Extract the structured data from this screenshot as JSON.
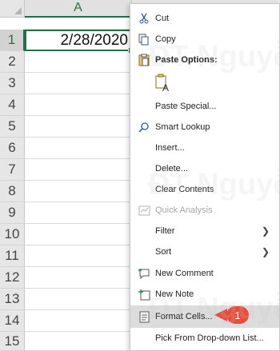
{
  "sheet": {
    "column_header": "A",
    "cell_a1": "2/28/2020",
    "row_numbers": [
      "1",
      "2",
      "3",
      "4",
      "5",
      "6",
      "7",
      "8",
      "9",
      "10",
      "11",
      "12",
      "13",
      "14",
      "15"
    ]
  },
  "context_menu": {
    "cut": "Cut",
    "copy": "Copy",
    "paste_options": "Paste Options:",
    "paste_special": "Paste Special...",
    "smart_lookup": "Smart Lookup",
    "insert": "Insert...",
    "delete": "Delete...",
    "clear_contents": "Clear Contents",
    "quick_analysis": "Quick Analysis",
    "filter": "Filter",
    "sort": "Sort",
    "new_comment": "New Comment",
    "new_note": "New Note",
    "format_cells": "Format Cells...",
    "pick_from_list": "Pick From Drop-down List..."
  },
  "annotation": {
    "badge": "1"
  },
  "watermark": "ĐT Nguyễn",
  "colors": {
    "excel_green": "#217346",
    "badge": "#e74c3c",
    "highlight": "#dcdcdc"
  }
}
